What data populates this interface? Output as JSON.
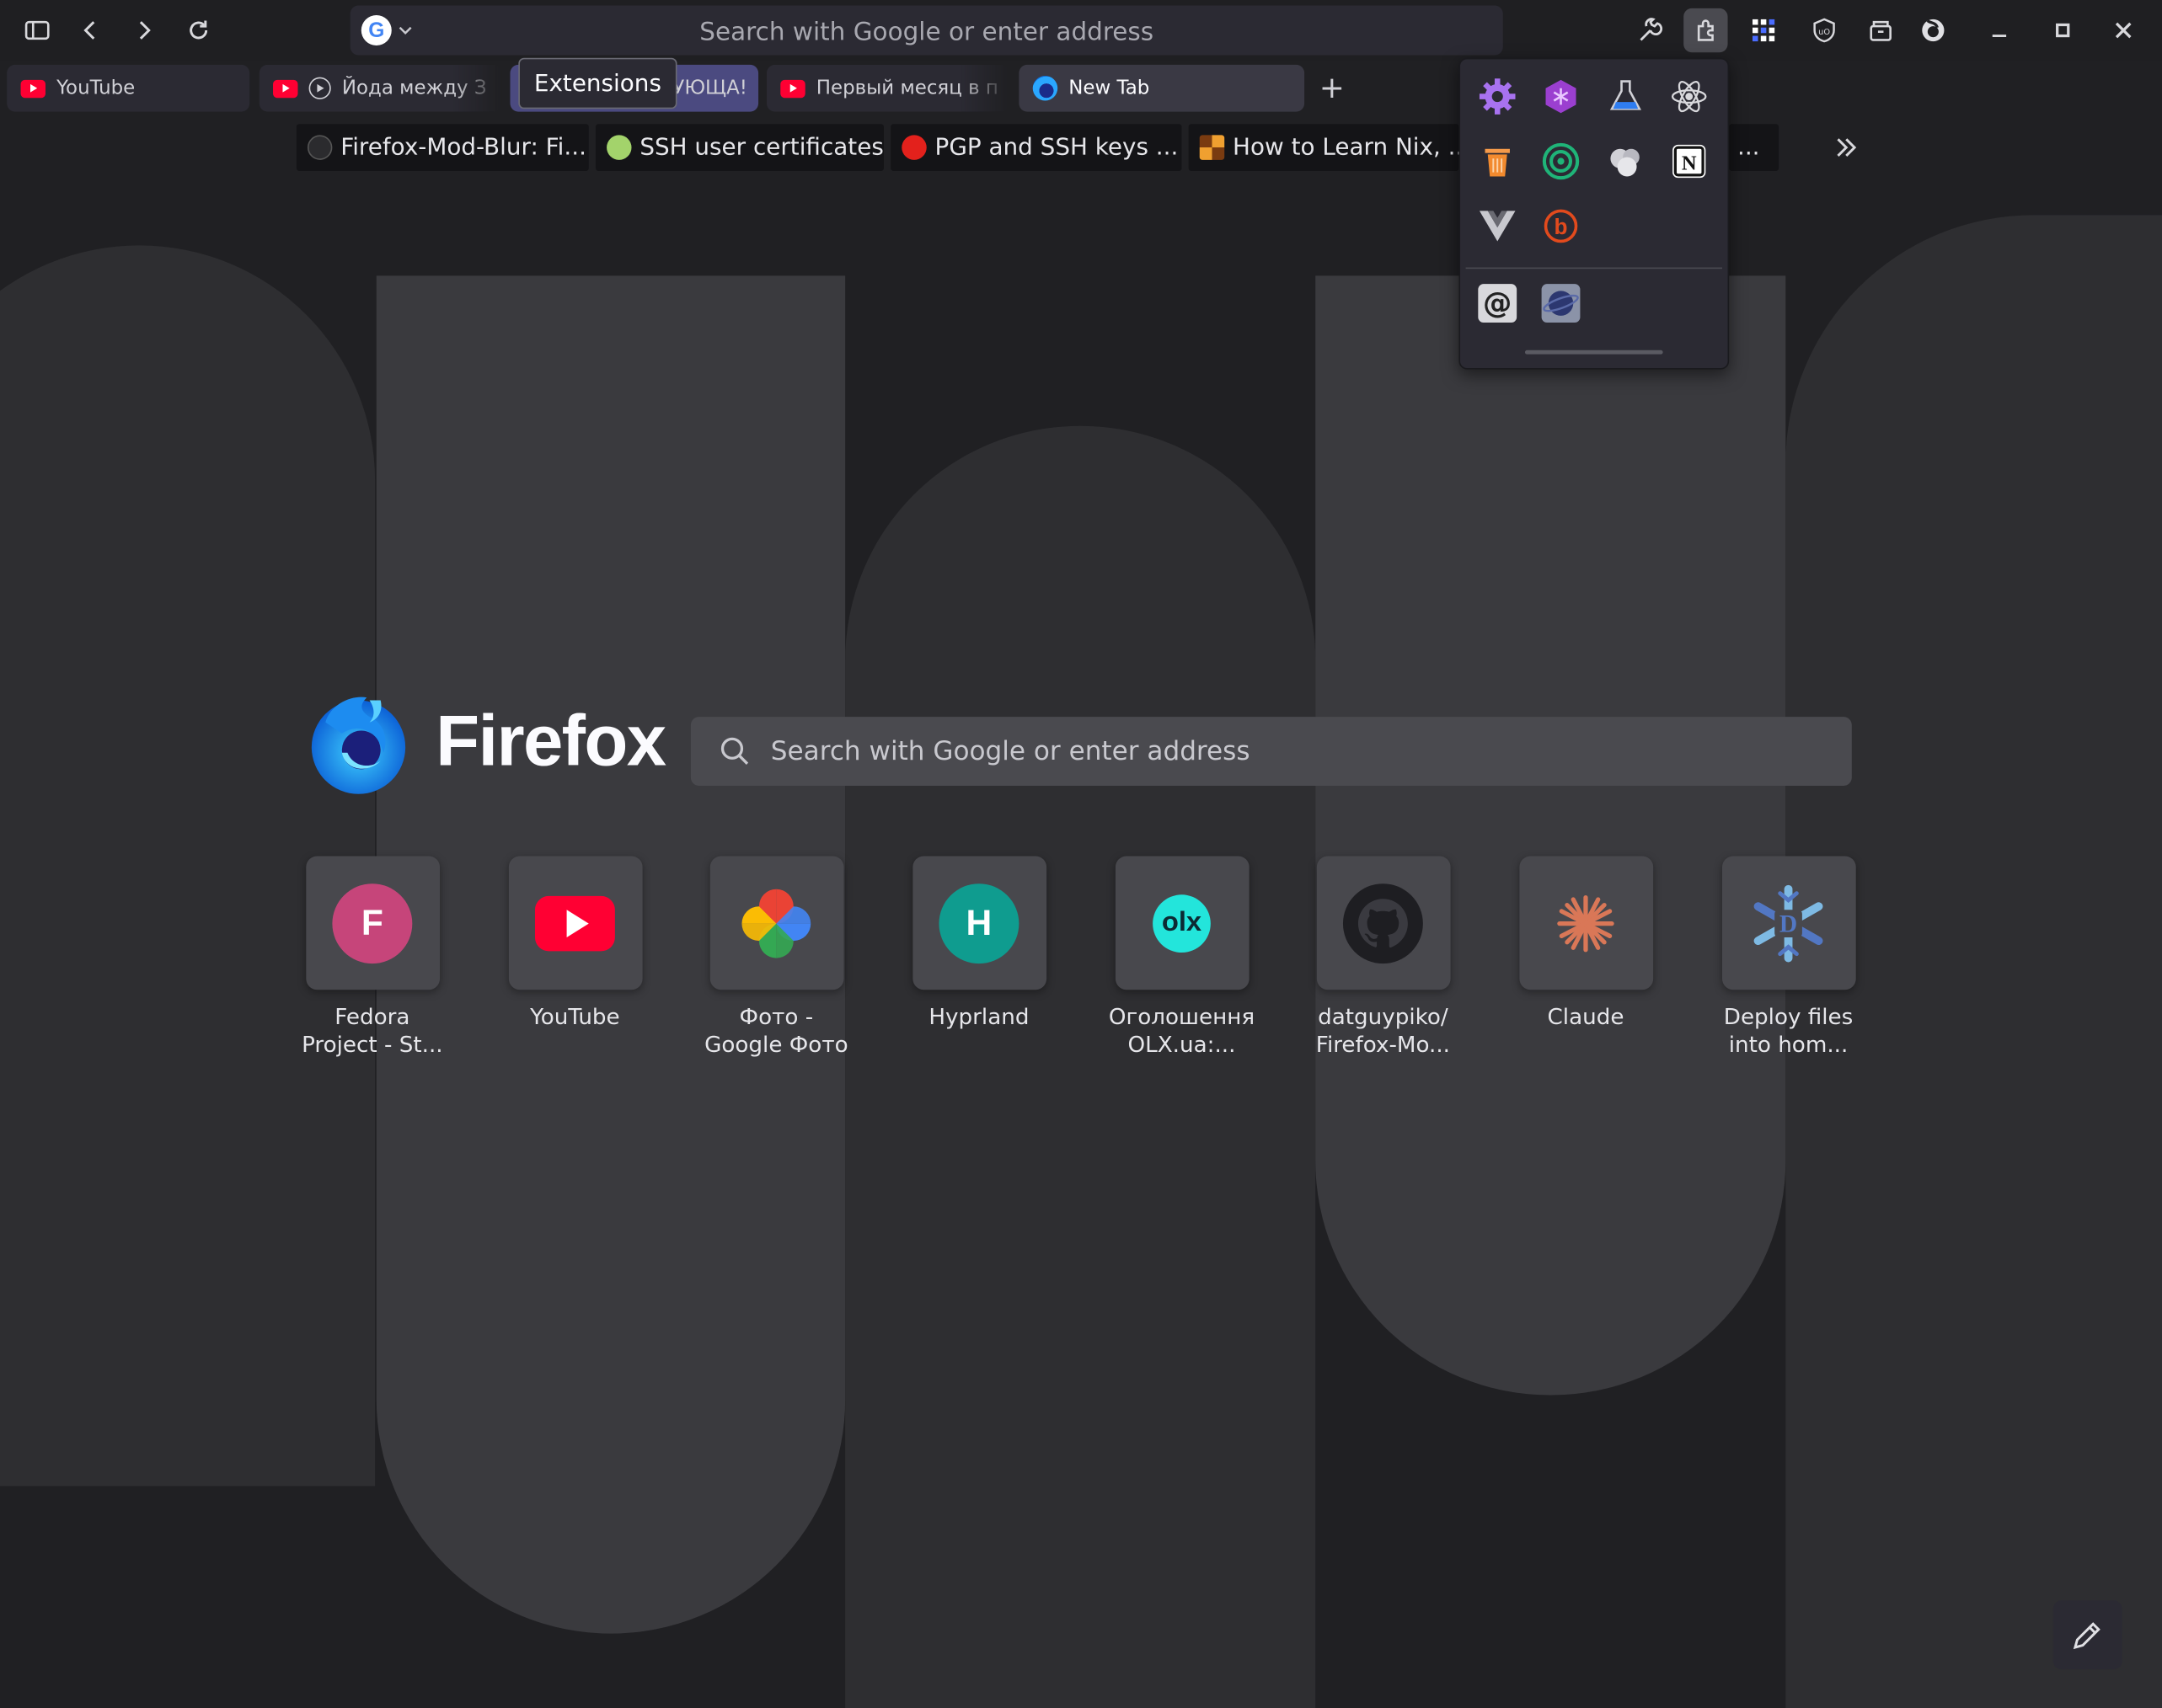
{
  "toolbar": {
    "url_placeholder": "Search with Google or enter address",
    "icons": [
      "sidebar-icon",
      "back-icon",
      "forward-icon",
      "reload-icon",
      "search-engine-google-icon",
      "chevron-down-icon",
      "wrench-icon",
      "extensions-icon",
      "grid-extension-icon",
      "ublock-icon",
      "container-icon",
      "firefox-account-icon",
      "minimize-icon",
      "maximize-icon",
      "close-icon"
    ]
  },
  "tabs": [
    {
      "title": "YouTube"
    },
    {
      "title": "Йода между З"
    },
    {
      "title": "УЮЩА!"
    },
    {
      "title": "Первый месяц в п"
    },
    {
      "title": "New Tab"
    }
  ],
  "tooltip": "Extensions",
  "bookmarks": [
    {
      "title": "Firefox-Mod-Blur: Fi..."
    },
    {
      "title": "SSH user certificates"
    },
    {
      "title": "PGP and SSH keys ..."
    },
    {
      "title": "How to Learn Nix, ..."
    },
    {
      "title": "..."
    }
  ],
  "hero": {
    "brand": "Firefox",
    "search_placeholder": "Search with Google or enter address"
  },
  "top_sites": [
    {
      "label": "Fedora\nProject - St...",
      "letter": "F"
    },
    {
      "label": "YouTube"
    },
    {
      "label": "Фото -\nGoogle Фото"
    },
    {
      "label": "Hyprland",
      "letter": "H"
    },
    {
      "label": "Оголошення\nOLX.ua:...",
      "letter": "olx"
    },
    {
      "label": "datguypiko/\nFirefox-Mo..."
    },
    {
      "label": "Claude"
    },
    {
      "label": "Deploy files\ninto hom..."
    }
  ],
  "colors": {
    "background": "#202023",
    "shape": "#3a3a3e",
    "accent_blue": "#0060df",
    "fedora_pink": "#c6457a",
    "hyprland_teal": "#0f9c8f",
    "olx_cyan": "#23e5db"
  }
}
